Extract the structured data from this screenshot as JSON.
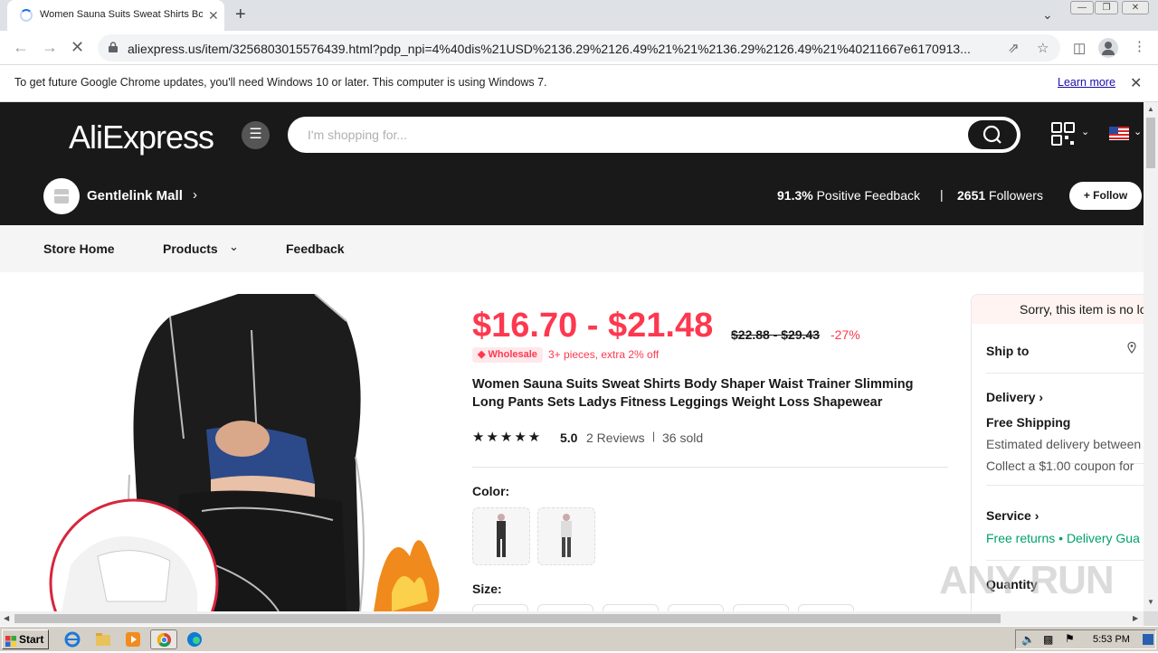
{
  "browser": {
    "tab_title": "Women Sauna Suits Sweat Shirts Bo",
    "tab_close": "✕",
    "new_tab": "+",
    "url": "aliexpress.us/item/3256803015576439.html?pdp_npi=4%40dis%21USD%2136.29%2126.49%21%21%2136.29%2126.49%21%40211667e6170913...",
    "infobar_text": "To get future Google Chrome updates, you'll need Windows 10 or later. This computer is using Windows 7.",
    "infobar_link": "Learn more"
  },
  "header": {
    "logo": "AliExpress",
    "search_placeholder": "I'm shopping for..."
  },
  "store": {
    "name": "Gentlelink Mall",
    "feedback_pct": "91.3%",
    "feedback_label": " Positive Feedback",
    "sep": "|",
    "followers_count": "2651",
    "followers_label": " Followers",
    "follow_button": "+ Follow"
  },
  "store_nav": {
    "home": "Store Home",
    "products": "Products",
    "feedback": "Feedback"
  },
  "product": {
    "price": "$16.70 - $21.48",
    "original_price": "$22.88 - $29.43",
    "discount": "-27%",
    "wholesale_badge": "Wholesale",
    "wholesale_text": "3+ pieces, extra 2% off",
    "title": "Women Sauna Suits Sweat Shirts Body Shaper Waist Trainer Slimming Long Pants Sets Ladys Fitness Leggings Weight Loss Shapewear",
    "stars": "★★★★★",
    "rating": "5.0",
    "reviews": "2 Reviews",
    "sep": "|",
    "sold": "36 sold",
    "color_label": "Color:",
    "size_label": "Size:"
  },
  "right_panel": {
    "notice": "Sorry, this item is no lo",
    "ship_to": "Ship to",
    "delivery": "Delivery",
    "free_shipping": "Free Shipping",
    "estimated": "Estimated delivery between",
    "coupon": "Collect a $1.00 coupon for",
    "service": "Service",
    "free_returns": "Free returns",
    "dot": " • ",
    "delivery_guarantee": "Delivery Gua",
    "quantity": "Quantity"
  },
  "taskbar": {
    "start": "Start",
    "clock": "5:53 PM"
  },
  "watermark": "ANY RUN",
  "colors": {
    "brand_dark": "#191919",
    "price_red": "#fd384f",
    "link_green": "#00a16b",
    "chrome_blue": "#1a73e8"
  }
}
